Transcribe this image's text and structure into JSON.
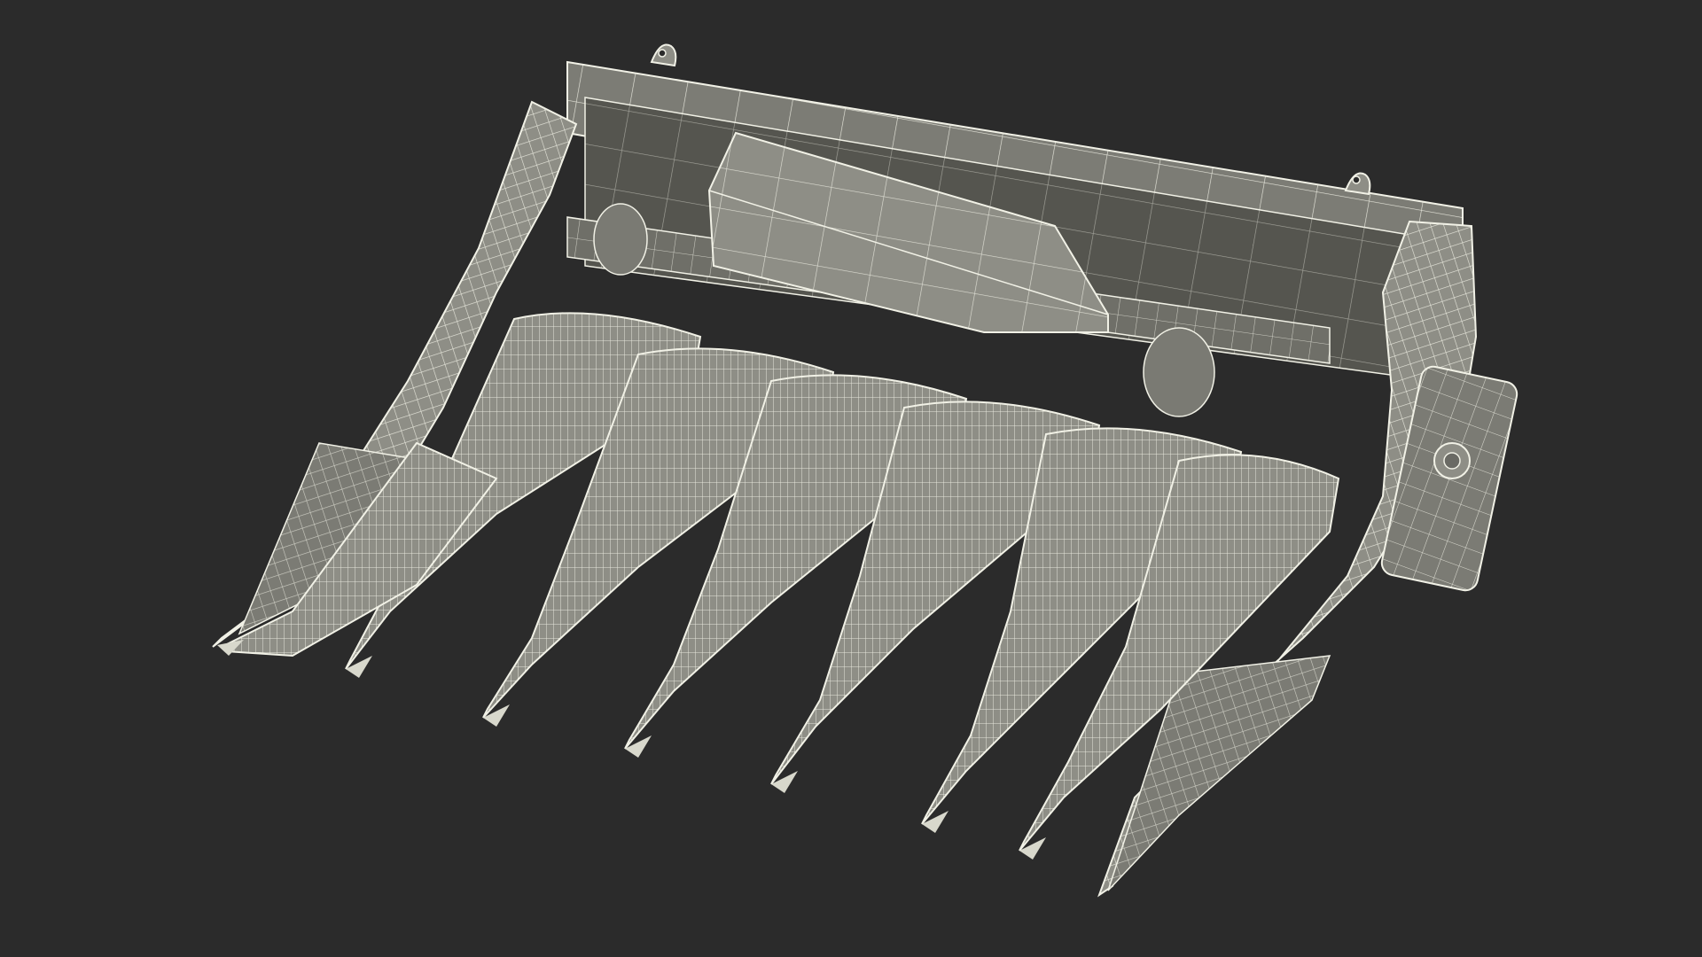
{
  "scene": {
    "background_color": "#2b2b2b",
    "model_fill_color": "#8e8e86",
    "model_shadow_color": "#64645e",
    "wireframe_color": "#f1f1e6",
    "snout_count": 7,
    "model": "wireframe-render"
  }
}
